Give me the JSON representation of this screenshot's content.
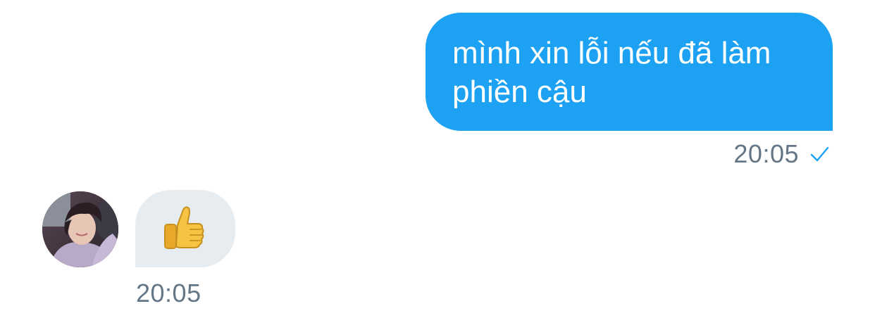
{
  "conversation": {
    "outgoing": {
      "line1": "mình xin lỗi nếu đã làm",
      "line2": "phiền cậu",
      "timestamp": "20:05",
      "status_icon": "checkmark-icon",
      "bubble_color": "#1da1f2"
    },
    "incoming": {
      "content_icon": "thumbs-up-emoji",
      "timestamp": "20:05",
      "bubble_color": "#e6ecf0",
      "avatar_icon": "avatar"
    }
  }
}
